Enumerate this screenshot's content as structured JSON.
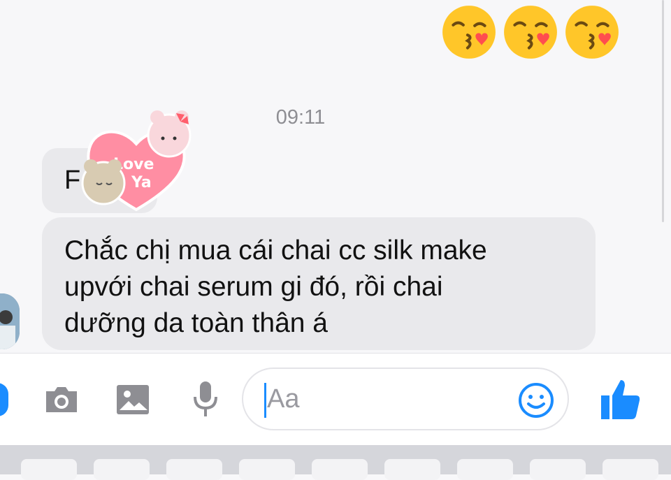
{
  "timestamp": "09:11",
  "messages": {
    "partial_bubble_text": "F",
    "main_lines": [
      "Chắc chị mua cái chai cc silk make",
      "upvới chai serum gi đó, rồi chai",
      "dưỡng da toàn thân á"
    ]
  },
  "sticker": {
    "line1": "Love",
    "line2": "Ya"
  },
  "sent_emojis": [
    "kissing-face-icon",
    "kissing-face-icon",
    "kissing-face-icon"
  ],
  "composer": {
    "placeholder": "Aa"
  },
  "colors": {
    "accent": "#1a8cff",
    "bubble": "#e9e9ec",
    "emoji": "#ffc629",
    "heart": "#ff5f7e"
  }
}
